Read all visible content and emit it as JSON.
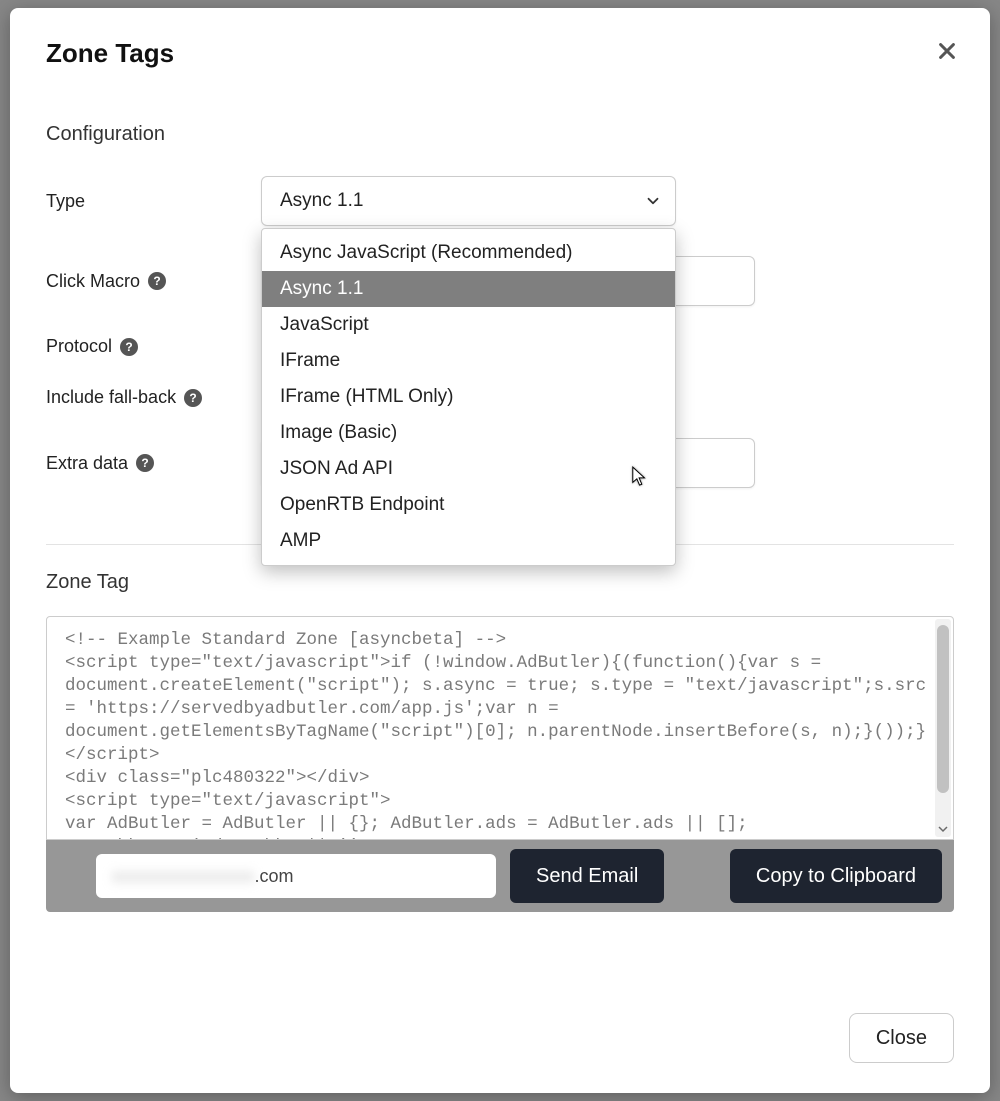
{
  "modal": {
    "title": "Zone Tags",
    "close_button": "Close"
  },
  "config": {
    "heading": "Configuration",
    "type_label": "Type",
    "type_selected": "Async 1.1",
    "type_options": [
      "Async JavaScript (Recommended)",
      "Async 1.1",
      "JavaScript",
      "IFrame",
      "IFrame (HTML Only)",
      "Image (Basic)",
      "JSON Ad API",
      "OpenRTB Endpoint",
      "AMP"
    ],
    "type_highlight_index": 1,
    "click_macro_label": "Click Macro",
    "click_macro_value": "",
    "protocol_label": "Protocol",
    "include_fallback_label": "Include fall-back",
    "extra_data_label": "Extra data",
    "extra_data_value": ""
  },
  "zone_tag": {
    "heading": "Zone Tag",
    "code": "<!-- Example Standard Zone [asyncbeta] -->\n<script type=\"text/javascript\">if (!window.AdButler){(function(){var s = document.createElement(\"script\"); s.async = true; s.type = \"text/javascript\";s.src = 'https://servedbyadbutler.com/app.js';var n = document.getElementsByTagName(\"script\")[0]; n.parentNode.insertBefore(s, n);}());}</script>\n<div class=\"plc480322\"></div>\n<script type=\"text/javascript\">\nvar AdButler = AdButler || {}; AdButler.ads = AdButler.ads || [];\nvar abkw = window.abkw || '';"
  },
  "actions": {
    "email_hidden_prefix": "xxxxxxxxxxxxxxx",
    "email_visible_suffix": ".com",
    "send_email": "Send Email",
    "copy_clipboard": "Copy to Clipboard"
  }
}
